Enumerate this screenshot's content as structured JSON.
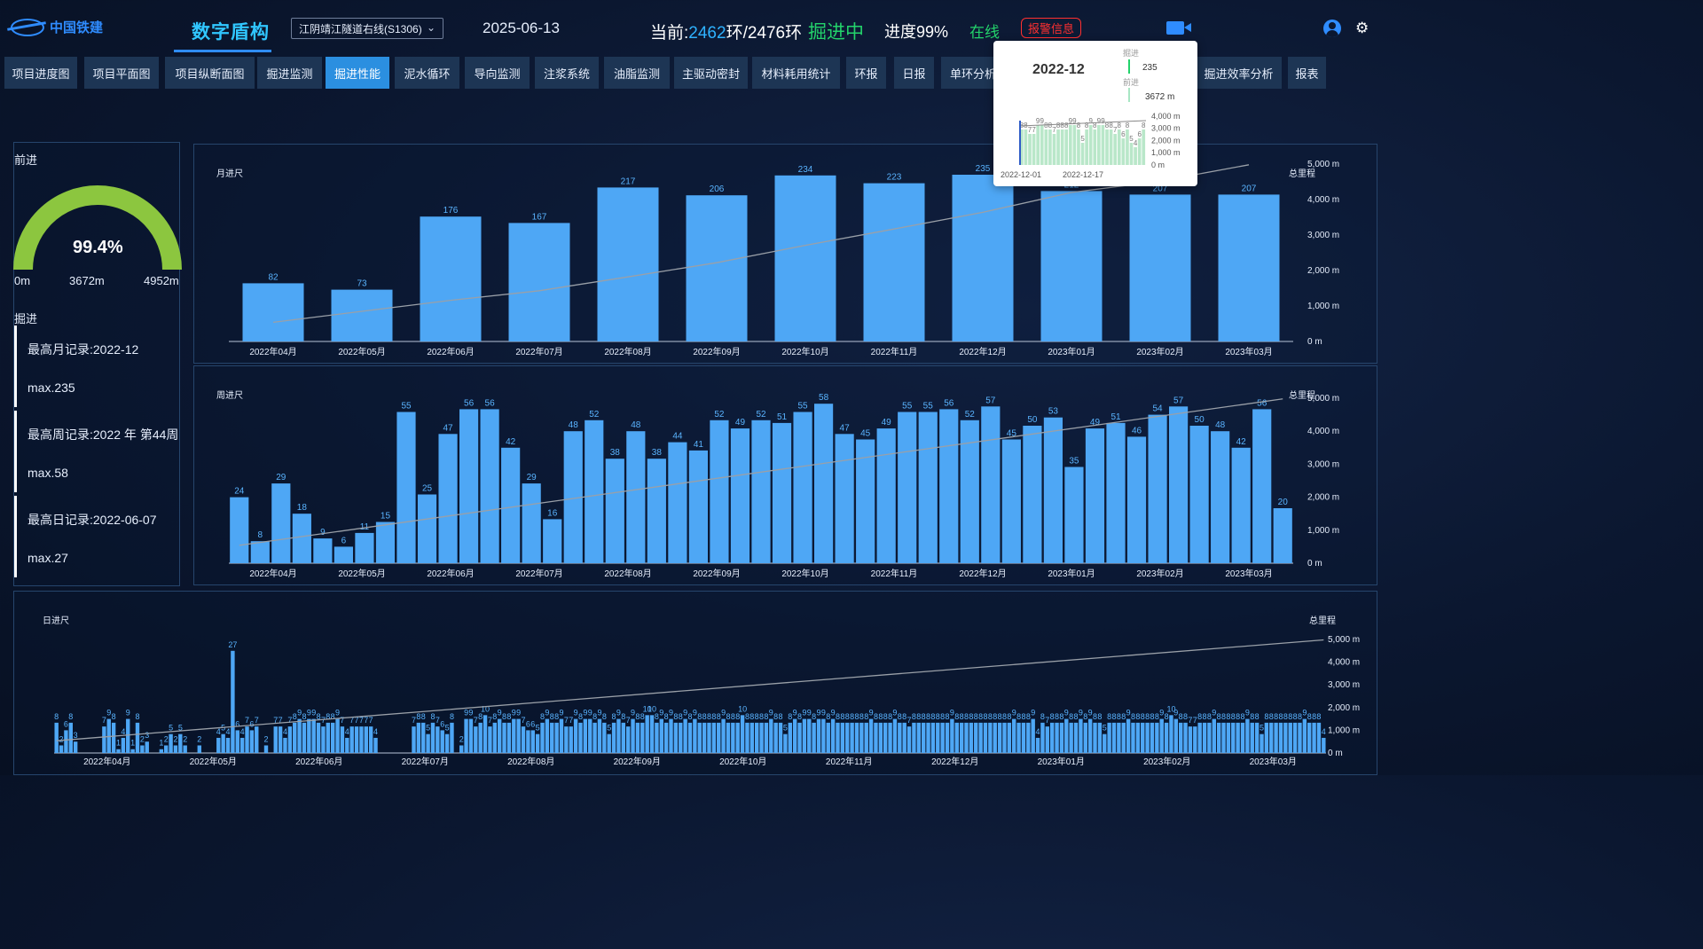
{
  "header": {
    "logo_text": "中国铁建",
    "app_title": "数字盾构",
    "project_select": "江阴靖江隧道右线(S1306)",
    "date": "2025-06-13",
    "rings_prefix": "当前:",
    "rings_current": "2462",
    "rings_suffix": "环/2476环",
    "digging_status": "掘进中",
    "progress_text": "进度99%",
    "online_status": "在线",
    "alarm_label": "报警信息"
  },
  "tabs": [
    {
      "label": "项目进度图",
      "active": false
    },
    {
      "label": "项目平面图",
      "active": false
    },
    {
      "label": "项目纵断面图",
      "active": false
    },
    {
      "label": "掘进监测",
      "active": false
    },
    {
      "label": "掘进性能",
      "active": true
    },
    {
      "label": "泥水循环",
      "active": false
    },
    {
      "label": "导向监测",
      "active": false
    },
    {
      "label": "注浆系统",
      "active": false
    },
    {
      "label": "油脂监测",
      "active": false
    },
    {
      "label": "主驱动密封",
      "active": false
    },
    {
      "label": "材料耗用统计",
      "active": false
    },
    {
      "label": "环报",
      "active": false
    },
    {
      "label": "日报",
      "active": false
    },
    {
      "label": "单环分析",
      "active": false
    },
    {
      "label": "掘进效率分析",
      "active": false
    },
    {
      "label": "报表",
      "active": false
    }
  ],
  "left_panel": {
    "advance_title": "前进",
    "gauge": {
      "percent_text": "99.4%",
      "percent": 0.994,
      "min_label": "0m",
      "mid_label": "3672m",
      "max_label": "4952m"
    },
    "excavation_title": "掘进",
    "records": [
      {
        "title": "最高月记录:2022-12",
        "max": "max.235"
      },
      {
        "title": "最高周记录:2022 年 第44周",
        "max": "max.58"
      },
      {
        "title": "最高日记录:2022-06-07",
        "max": "max.27"
      }
    ]
  },
  "colors": {
    "bar": "#4ea7f5",
    "bar_highlight": "#5ab4ff",
    "line": "#9aa0a8",
    "accent_green": "#23d36b",
    "alarm": "#ff3030"
  },
  "chart_data": [
    {
      "type": "bar",
      "title": "月进尺",
      "right_axis_title": "总里程",
      "categories": [
        "2022年04月",
        "2022年05月",
        "2022年06月",
        "2022年07月",
        "2022年08月",
        "2022年09月",
        "2022年10月",
        "2022年11月",
        "2022年12月",
        "2023年01月",
        "2023年02月",
        "2023年03月"
      ],
      "values": [
        82,
        73,
        176,
        167,
        217,
        206,
        234,
        223,
        235,
        212,
        207,
        207
      ],
      "cumulative_line": [
        540,
        850,
        1160,
        1430,
        1820,
        2220,
        2710,
        3170,
        3640,
        4200,
        4520,
        4980
      ],
      "right_ticks": [
        "0 m",
        "1,000 m",
        "2,000 m",
        "3,000 m",
        "4,000 m",
        "5,000 m"
      ],
      "ylim": [
        0,
        250
      ],
      "y2lim": [
        0,
        5000
      ]
    },
    {
      "type": "bar",
      "title": "周进尺",
      "right_axis_title": "总里程",
      "categories": [
        "2022年04月",
        "2022年05月",
        "2022年06月",
        "2022年07月",
        "2022年08月",
        "2022年09月",
        "2022年10月",
        "2022年11月",
        "2022年12月",
        "2023年01月",
        "2023年02月",
        "2023年03月"
      ],
      "values": [
        24,
        8,
        29,
        18,
        9,
        6,
        11,
        15,
        55,
        25,
        47,
        56,
        56,
        42,
        29,
        16,
        48,
        52,
        38,
        48,
        38,
        44,
        41,
        52,
        49,
        52,
        51,
        55,
        58,
        47,
        45,
        49,
        55,
        55,
        56,
        52,
        57,
        45,
        50,
        53,
        35,
        49,
        51,
        46,
        54,
        57,
        50,
        48,
        42,
        56,
        20
      ],
      "cumulative_start": 540,
      "cumulative_end": 4980,
      "right_ticks": [
        "0 m",
        "1,000 m",
        "2,000 m",
        "3,000 m",
        "4,000 m",
        "5,000 m"
      ],
      "ylim": [
        0,
        60
      ],
      "y2lim": [
        0,
        5000
      ]
    },
    {
      "type": "bar",
      "title": "日进尺",
      "right_axis_title": "总里程",
      "categories": [
        "2022年04月",
        "2022年05月",
        "2022年06月",
        "2022年07月",
        "2022年08月",
        "2022年09月",
        "2022年10月",
        "2022年11月",
        "2022年12月",
        "2023年01月",
        "2023年02月",
        "2023年03月"
      ],
      "values": [
        8,
        2,
        6,
        8,
        3,
        0,
        0,
        0,
        0,
        0,
        7,
        9,
        8,
        1,
        4,
        9,
        1,
        8,
        2,
        3,
        0,
        0,
        1,
        2,
        5,
        2,
        5,
        2,
        0,
        0,
        2,
        0,
        0,
        0,
        4,
        5,
        4,
        27,
        6,
        4,
        7,
        6,
        7,
        0,
        2,
        0,
        7,
        7,
        4,
        7,
        8,
        9,
        8,
        9,
        9,
        8,
        7,
        8,
        8,
        9,
        7,
        4,
        7,
        7,
        7,
        7,
        7,
        4,
        0,
        0,
        0,
        0,
        0,
        0,
        0,
        7,
        8,
        8,
        5,
        8,
        7,
        6,
        5,
        8,
        0,
        2,
        9,
        9,
        7,
        8,
        10,
        7,
        8,
        9,
        8,
        8,
        9,
        9,
        7,
        6,
        6,
        5,
        8,
        9,
        8,
        8,
        9,
        7,
        7,
        9,
        8,
        9,
        9,
        8,
        9,
        8,
        5,
        8,
        9,
        8,
        7,
        9,
        8,
        8,
        10,
        10,
        8,
        9,
        8,
        9,
        8,
        8,
        9,
        8,
        9,
        8,
        8,
        8,
        8,
        8,
        9,
        8,
        8,
        8,
        10,
        8,
        8,
        8,
        8,
        8,
        9,
        8,
        8,
        5,
        8,
        9,
        8,
        9,
        9,
        8,
        9,
        9,
        8,
        9,
        8,
        8,
        8,
        8,
        8,
        8,
        8,
        9,
        8,
        8,
        8,
        8,
        9,
        8,
        8,
        7,
        8,
        8,
        8,
        8,
        8,
        8,
        8,
        8,
        9,
        8,
        8,
        8,
        8,
        8,
        8,
        8,
        8,
        8,
        8,
        8,
        8,
        9,
        8,
        8,
        8,
        9,
        4,
        8,
        7,
        8,
        8,
        8,
        9,
        8,
        8,
        9,
        8,
        9,
        8,
        8,
        5,
        8,
        8,
        8,
        8,
        9,
        8,
        8,
        8,
        8,
        8,
        8,
        9,
        8,
        10,
        9,
        8,
        8,
        7,
        7,
        8,
        8,
        8,
        9,
        8,
        8,
        8,
        8,
        8,
        8,
        9,
        8,
        8,
        5,
        8,
        8,
        8,
        8,
        8,
        8,
        8,
        8,
        9,
        8,
        8,
        8,
        4
      ],
      "cumulative_start": 540,
      "cumulative_end": 4980,
      "right_ticks": [
        "0 m",
        "1,000 m",
        "2,000 m",
        "3,000 m",
        "4,000 m",
        "5,000 m"
      ],
      "ylim": [
        0,
        30
      ],
      "y2lim": [
        0,
        5000
      ]
    }
  ],
  "tooltip": {
    "title": "2022-12",
    "label_excavation": "掘进",
    "excavation_value": "235",
    "label_advance": "前进",
    "advance_value": "3672 m",
    "mini_y_ticks": [
      "4,000 m",
      "3,000 m",
      "2,000 m",
      "1,000 m",
      "0 m"
    ],
    "mini_x_ticks": [
      "2022-12-01",
      "2022-12-17"
    ],
    "mini_values": [
      8,
      8,
      7,
      7,
      9,
      9,
      8,
      8,
      7,
      8,
      8,
      8,
      9,
      9,
      8,
      5,
      8,
      9,
      8,
      9,
      9,
      8,
      8,
      7,
      8,
      6,
      8,
      5,
      4,
      6,
      8
    ]
  }
}
